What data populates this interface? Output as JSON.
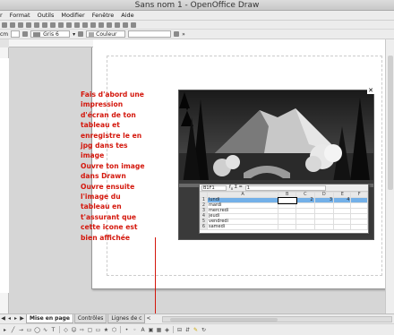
{
  "window": {
    "title": "Sans nom 1 - OpenOffice Draw"
  },
  "menu": [
    "r",
    "Format",
    "Outils",
    "Modifier",
    "Fenêtre",
    "Aide"
  ],
  "line_toolbar": {
    "unit_label": "cm",
    "fill_style": "Gris 6",
    "color_label": "Couleur"
  },
  "note": {
    "color": "#d4170c",
    "lines": [
      "Fais d'abord une",
      "impression",
      "d'écran de ton",
      "tableau et",
      "enregistre le en",
      "jpg dans tes",
      "image",
      "Ouvre ton image",
      "dans Drawn",
      "Ouvre ensuite",
      "l'image du",
      "tableau en",
      "t'assurant que",
      "cette icone est",
      "bien affichée"
    ]
  },
  "spreadsheet": {
    "cell_ref": "B1F1",
    "formula_value": "1",
    "columns": [
      "",
      "A",
      "B",
      "C",
      "D",
      "E",
      "F"
    ],
    "rows": [
      {
        "n": "1",
        "cells": [
          "lundi",
          "",
          "2",
          "3",
          "4",
          ""
        ]
      },
      {
        "n": "2",
        "cells": [
          "mardi",
          "",
          "",
          "",
          "",
          ""
        ]
      },
      {
        "n": "3",
        "cells": [
          "mercredi",
          "",
          "",
          "",
          "",
          ""
        ]
      },
      {
        "n": "4",
        "cells": [
          "jeudi",
          "",
          "",
          "",
          "",
          ""
        ]
      },
      {
        "n": "5",
        "cells": [
          "vendredi",
          "",
          "",
          "",
          "",
          ""
        ]
      },
      {
        "n": "6",
        "cells": [
          "samedi",
          "",
          "",
          "",
          "",
          ""
        ]
      }
    ]
  },
  "tabs": [
    "Mise en page",
    "Contrôles",
    "Lignes de c"
  ]
}
